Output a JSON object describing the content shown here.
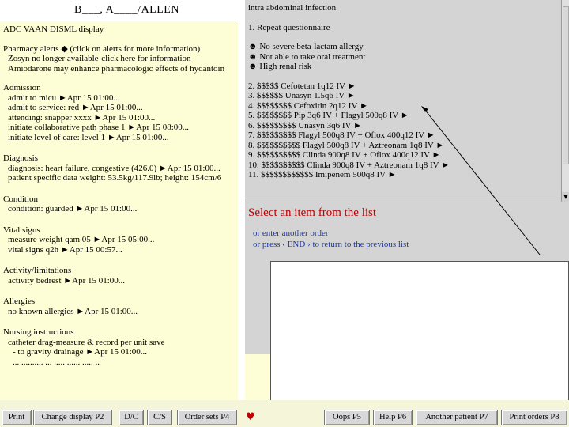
{
  "patient": {
    "name": "B___, A____/ALLEN"
  },
  "left_panel": {
    "display_title": "ADC VAAN DISML display",
    "pharmacy_alerts": {
      "title": "Pharmacy alerts",
      "hint": "(click on alerts for more information)",
      "items": [
        "Zosyn no longer available-click here for information",
        "Amiodarone may enhance pharmacologic effects of hydantoin"
      ]
    },
    "admission": {
      "title": "Admission",
      "items": [
        "admit to micu  ►Apr 15 01:00...",
        "admit to service: red  ►Apr 15 01:00...",
        "attending: snapper xxxx  ►Apr 15 01:00...",
        "initiate collaborative path phase 1  ►Apr 15 08:00...",
        "initiate level of care: level 1  ►Apr 15 01:00..."
      ]
    },
    "diagnosis": {
      "title": "Diagnosis",
      "items": [
        "diagnosis: heart failure, congestive (426.0)  ►Apr 15 01:00...",
        "patient specific data weight: 53.5kg/117.9lb; height: 154cm/6"
      ]
    },
    "condition": {
      "title": "Condition",
      "items": [
        "condition: guarded  ►Apr 15 01:00..."
      ]
    },
    "vital_signs": {
      "title": "Vital signs",
      "items": [
        "measure weight qam 05  ►Apr 15 05:00...",
        "vital signs q2h  ►Apr 15 00:57..."
      ]
    },
    "activity": {
      "title": "Activity/limitations",
      "items": [
        "activity bedrest  ►Apr 15 01:00..."
      ]
    },
    "allergies": {
      "title": "Allergies",
      "items": [
        "no known allergies  ►Apr 15 01:00..."
      ]
    },
    "nursing": {
      "title": "Nursing instructions",
      "items": [
        "catheter drag-measure & record per unit save",
        "- to gravity drainage  ►Apr 15 01:00...",
        "... ..........  ... ..... ...... ..... .."
      ]
    }
  },
  "orders": {
    "header": "intra abdominal infection",
    "question": "1. Repeat questionnaire",
    "criteria": [
      "No severe beta-lactam allergy",
      "Not able to take oral treatment",
      "High renal risk"
    ],
    "items": [
      "2. $$$$$ Cefotetan 1q12 IV ►",
      "3. $$$$$$ Unasyn 1.5q6 IV ►",
      "4. $$$$$$$$ Cefoxitin 2q12 IV ►",
      "5. $$$$$$$$ Pip 3q6 IV + Flagyl 500q8 IV ►",
      "6. $$$$$$$$$ Unasyn 3q6 IV ►",
      "7. $$$$$$$$$ Flagyl 500q8 IV + Oflox 400q12 IV ►",
      "8. $$$$$$$$$$ Flagyl 500q8 IV + Aztreonam 1q8 IV ►",
      "9. $$$$$$$$$$ Clinda 900q8 IV + Oflox 400q12 IV ►",
      "10. $$$$$$$$$$ Clinda 900q8 IV + Aztreonam 1q8 IV ►",
      "11. $$$$$$$$$$$$ Imipenem 500q8 IV ►"
    ]
  },
  "prompt": {
    "select": "Select an item from the list",
    "enter": "or enter another order",
    "press_end": "or press ‹ END › to return to the previous list"
  },
  "toolbar": {
    "print": "Print",
    "change_display": "Change display P2",
    "dc": "D/C",
    "cs": "C/S",
    "order_sets": "Order sets P4",
    "oops": "Oops P5",
    "help": "Help P6",
    "another_patient": "Another patient P7",
    "print_orders": "Print orders P8"
  },
  "colors": {
    "left_bg": "#fefed6",
    "right_bg": "#d4d4d4",
    "prompt_red": "#c00000",
    "prompt_blue": "#1f3aa3"
  },
  "icons": {
    "bullet": "smiley-bullet-icon",
    "alert": "diamond-icon",
    "heart": "heart-icon"
  }
}
